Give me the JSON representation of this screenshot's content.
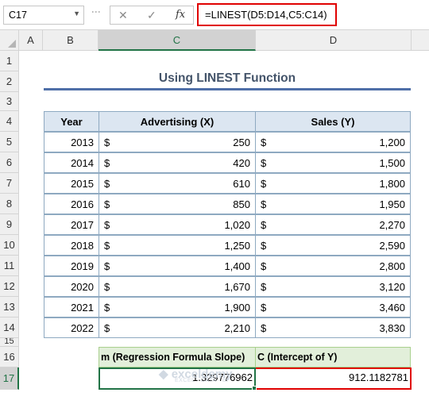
{
  "formula_bar": {
    "name_box": "C17",
    "cancel_icon": "✕",
    "enter_icon": "✓",
    "function_icon": "fx",
    "formula": "=LINEST(D5:D14,C5:C14)"
  },
  "columns": [
    "A",
    "B",
    "C",
    "D"
  ],
  "rows": [
    "1",
    "2",
    "3",
    "4",
    "5",
    "6",
    "7",
    "8",
    "9",
    "10",
    "11",
    "12",
    "13",
    "14",
    "15",
    "16",
    "17"
  ],
  "title": "Using LINEST Function",
  "table": {
    "headers": [
      "Year",
      "Advertising (X)",
      "Sales (Y)"
    ],
    "currency_symbol": "$",
    "rows": [
      {
        "year": "2013",
        "advertising": "250",
        "sales": "1,200"
      },
      {
        "year": "2014",
        "advertising": "420",
        "sales": "1,500"
      },
      {
        "year": "2015",
        "advertising": "610",
        "sales": "1,800"
      },
      {
        "year": "2016",
        "advertising": "850",
        "sales": "1,950"
      },
      {
        "year": "2017",
        "advertising": "1,020",
        "sales": "2,270"
      },
      {
        "year": "2018",
        "advertising": "1,250",
        "sales": "2,590"
      },
      {
        "year": "2019",
        "advertising": "1,400",
        "sales": "2,800"
      },
      {
        "year": "2020",
        "advertising": "1,670",
        "sales": "3,120"
      },
      {
        "year": "2021",
        "advertising": "1,900",
        "sales": "3,460"
      },
      {
        "year": "2022",
        "advertising": "2,210",
        "sales": "3,830"
      }
    ]
  },
  "results": {
    "slope_label": "m (Regression Formula Slope)",
    "intercept_label": "C (Intercept of Y)",
    "slope_value": "1.329776962",
    "intercept_value": "912.1182781"
  },
  "watermark": {
    "name": "exceldemy",
    "tagline": "EXCEL · DATA · BI"
  },
  "colors": {
    "highlight_border": "#e00000",
    "selection": "#217346",
    "header_fill": "#dce6f1",
    "result_header_fill": "#e2efda"
  }
}
